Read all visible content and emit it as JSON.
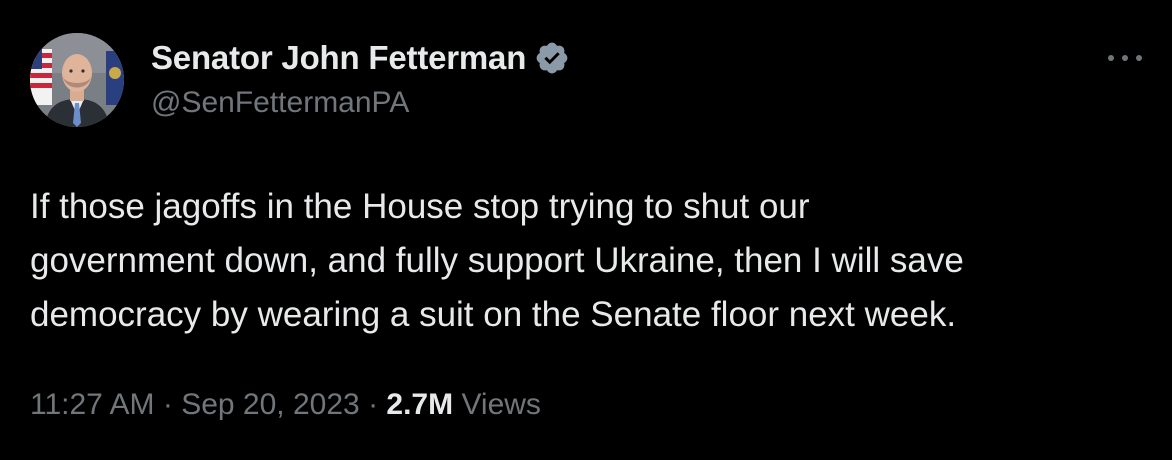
{
  "author": {
    "display_name": "Senator John Fetterman",
    "handle": "@SenFettermanPA",
    "verified_icon": "verified-badge-icon"
  },
  "tweet": {
    "lines": [
      "If those jagoffs in the House stop trying to shut our",
      "government down, and fully support Ukraine, then I will save",
      "democracy by wearing a suit on the Senate floor next week."
    ]
  },
  "meta": {
    "time": "11:27 AM",
    "separator": "·",
    "date": "Sep 20, 2023",
    "views_count": "2.7M",
    "views_label": "Views"
  },
  "colors": {
    "background": "#000000",
    "primary_text": "#e7e9ea",
    "secondary_text": "#71767b"
  },
  "icons": {
    "more": "more-options-icon"
  }
}
